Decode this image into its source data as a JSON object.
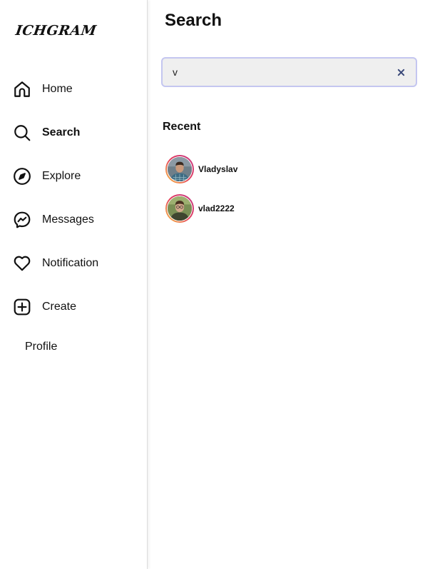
{
  "app": {
    "logo_text": "ICHGRAM"
  },
  "sidebar": {
    "items": [
      {
        "label": "Home",
        "icon": "home-icon"
      },
      {
        "label": "Search",
        "icon": "search-icon",
        "active": true
      },
      {
        "label": "Explore",
        "icon": "compass-icon"
      },
      {
        "label": "Messages",
        "icon": "messenger-icon"
      },
      {
        "label": "Notification",
        "icon": "heart-icon"
      },
      {
        "label": "Create",
        "icon": "plus-square-icon"
      }
    ],
    "profile_label": "Profile"
  },
  "main": {
    "title": "Search",
    "search": {
      "value": "v",
      "placeholder": ""
    },
    "recent_title": "Recent",
    "results": [
      {
        "username": "Vladyslav",
        "avatar": "avatar-photo"
      },
      {
        "username": "vlad2222",
        "avatar": "avatar-photo"
      }
    ]
  },
  "colors": {
    "search_bg": "#efefef",
    "search_border": "#c4c6f0",
    "clear_icon": "#3b4a7a",
    "avatar_ring": [
      "#f5c440",
      "#e4405f",
      "#c13584"
    ]
  }
}
